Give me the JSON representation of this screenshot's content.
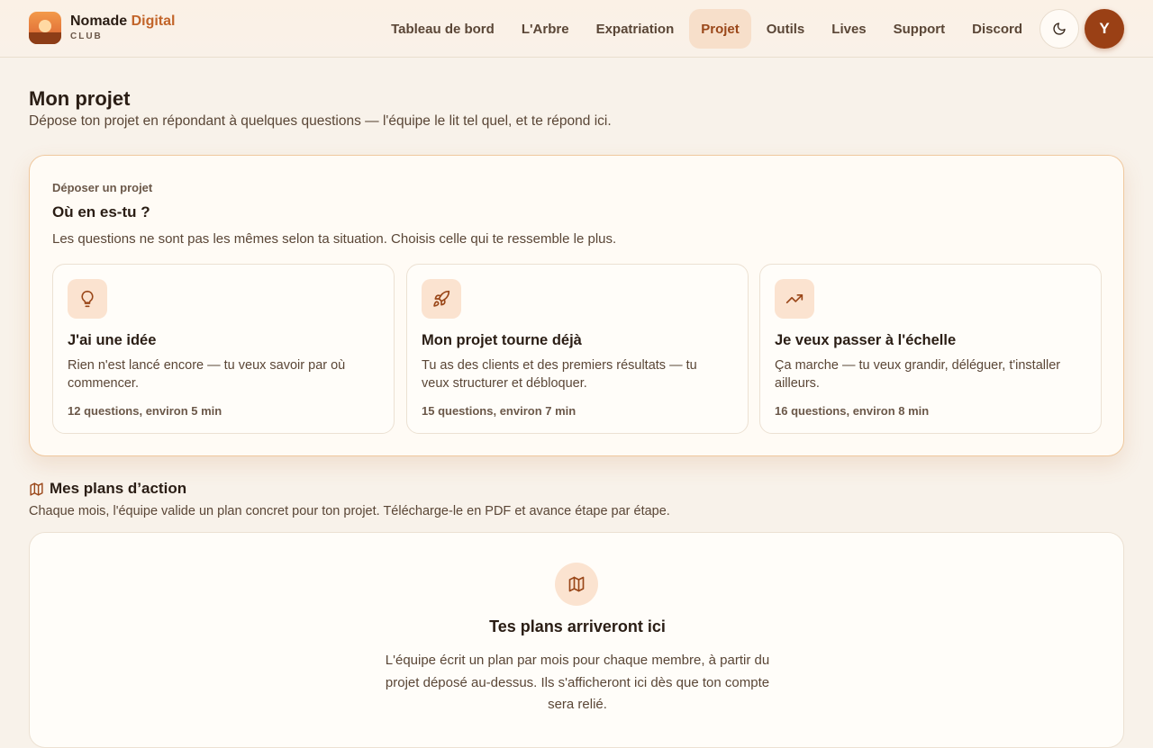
{
  "brand": {
    "title_main": "Nomade ",
    "title_accent": "Digital",
    "subtitle": "CLUB"
  },
  "nav": {
    "items": [
      {
        "label": "Tableau de bord",
        "active": false
      },
      {
        "label": "L'Arbre",
        "active": false
      },
      {
        "label": "Expatriation",
        "active": false
      },
      {
        "label": "Projet",
        "active": true
      },
      {
        "label": "Outils",
        "active": false
      },
      {
        "label": "Lives",
        "active": false
      },
      {
        "label": "Support",
        "active": false
      },
      {
        "label": "Discord",
        "active": false
      }
    ],
    "theme_toggle_icon": "moon-icon",
    "avatar_initial": "Y"
  },
  "page": {
    "title": "Mon projet",
    "subtitle": "Dépose ton projet en répondant à quelques questions — l'équipe le lit tel quel, et te répond ici."
  },
  "deposit": {
    "eyebrow": "Déposer un projet",
    "title": "Où en es-tu ?",
    "description": "Les questions ne sont pas les mêmes selon ta situation. Choisis celle qui te ressemble le plus.",
    "choices": [
      {
        "icon": "lightbulb-icon",
        "title": "J'ai une idée",
        "description": "Rien n'est lancé encore — tu veux savoir par où commencer.",
        "meta": "12 questions, environ 5 min"
      },
      {
        "icon": "rocket-icon",
        "title": "Mon projet tourne déjà",
        "description": "Tu as des clients et des premiers résultats — tu veux structurer et débloquer.",
        "meta": "15 questions, environ 7 min"
      },
      {
        "icon": "trending-up-icon",
        "title": "Je veux passer à l'échelle",
        "description": "Ça marche — tu veux grandir, déléguer, t'installer ailleurs.",
        "meta": "16 questions, environ 8 min"
      }
    ]
  },
  "plans": {
    "icon": "map-icon",
    "title": "Mes plans d’action",
    "description": "Chaque mois, l'équipe valide un plan concret pour ton projet. Télécharge-le en PDF et avance étape par étape.",
    "empty_title": "Tes plans arriveront ici",
    "empty_description": "L'équipe écrit un plan par mois pour chaque membre, à partir du projet déposé au-dessus. Ils s'afficheront ici dès que ton compte sera relié."
  },
  "colors": {
    "accent": "#c2652a",
    "avatar_bg": "#9a4015",
    "background": "#f8f2ea"
  }
}
